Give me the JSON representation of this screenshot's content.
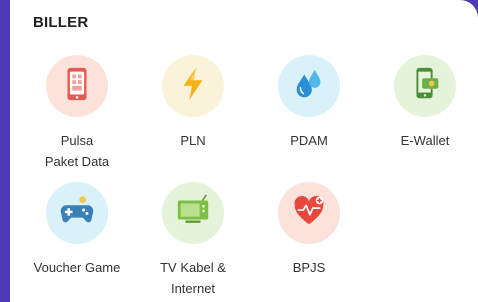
{
  "section": {
    "title": "BILLER"
  },
  "items": [
    {
      "label": "Pulsa\nPaket Data",
      "icon": "phone-icon",
      "bg": "#fde2dc"
    },
    {
      "label": "PLN",
      "icon": "lightning-icon",
      "bg": "#fbf3d9"
    },
    {
      "label": "PDAM",
      "icon": "water-drop-icon",
      "bg": "#d9f1f9"
    },
    {
      "label": "E-Wallet",
      "icon": "wallet-icon",
      "bg": "#e5f3da"
    },
    {
      "label": "Voucher Game",
      "icon": "gamepad-icon",
      "bg": "#d9f1f9"
    },
    {
      "label": "TV Kabel &\nInternet",
      "icon": "tv-icon",
      "bg": "#e5f3da"
    },
    {
      "label": "BPJS",
      "icon": "health-heart-icon",
      "bg": "#fde2dc"
    }
  ],
  "colors": {
    "background": "#4a3bb5",
    "card": "#ffffff"
  }
}
